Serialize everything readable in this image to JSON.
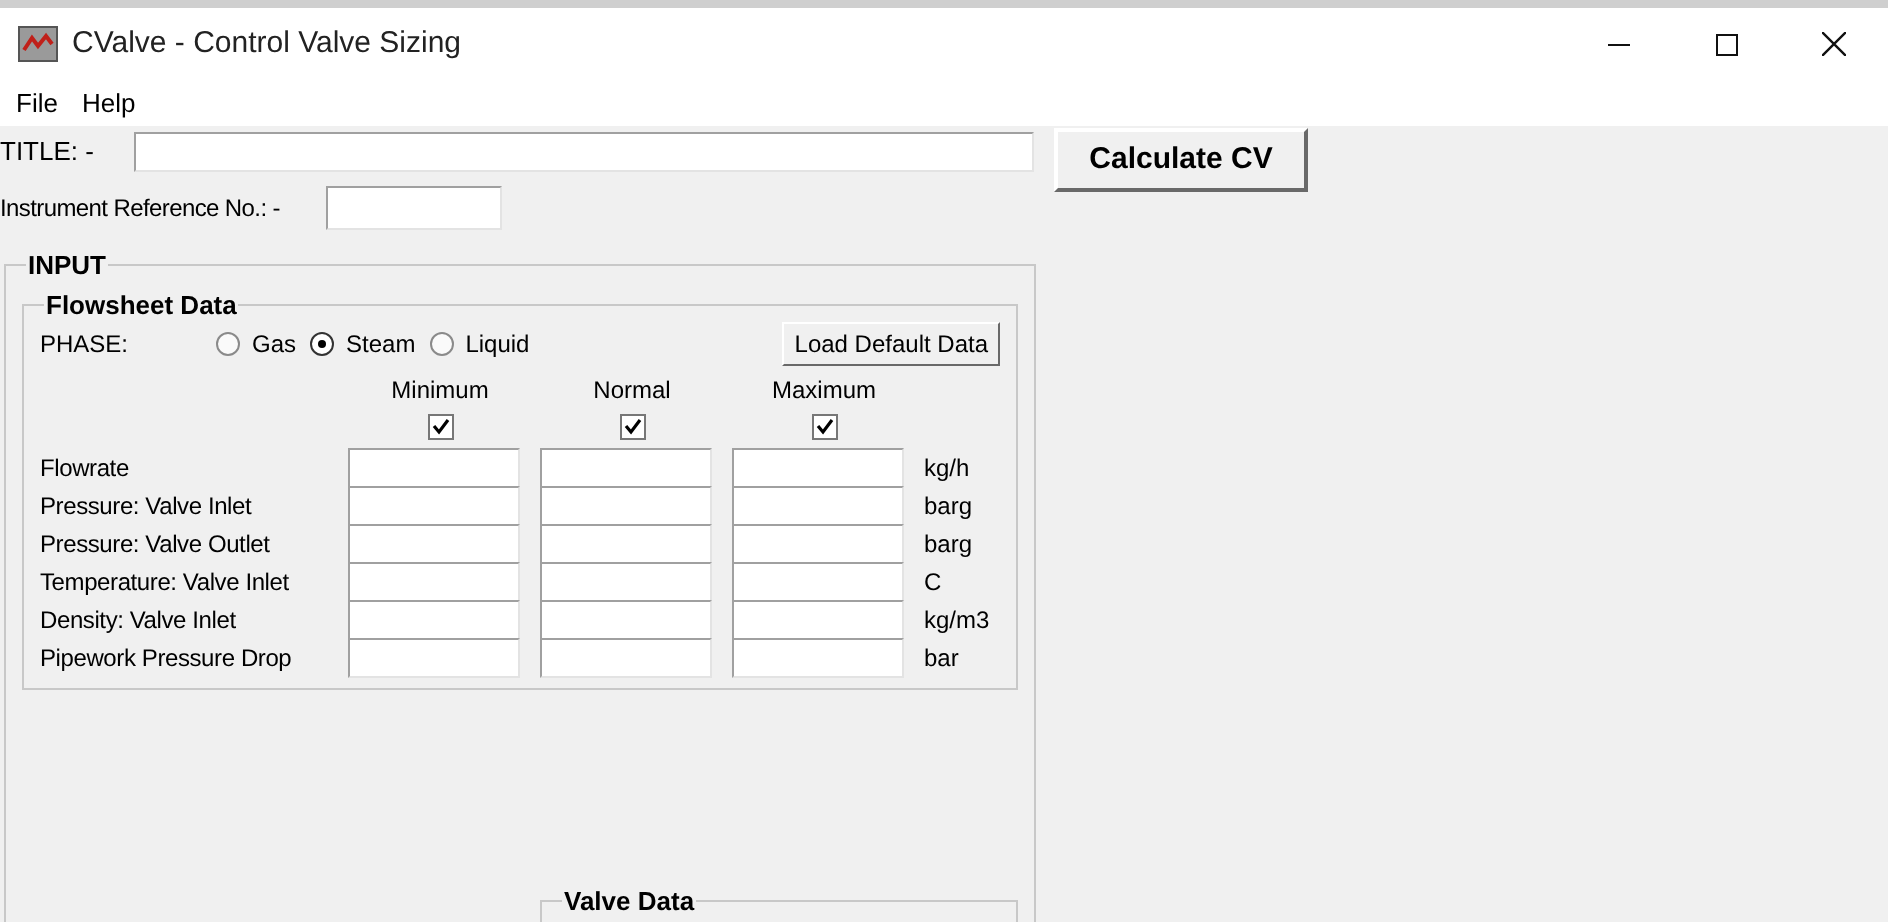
{
  "window": {
    "title": "CValve - Control Valve Sizing"
  },
  "menu": [
    {
      "label": "File"
    },
    {
      "label": "Help"
    }
  ],
  "title_field": {
    "label": "TITLE: -"
  },
  "instrument_ref": {
    "label": "Instrument Reference No.: -"
  },
  "calculate_button": "Calculate CV",
  "input_group": {
    "label": "INPUT",
    "flowsheet": {
      "label": "Flowsheet Data",
      "phase_label": "PHASE:",
      "phases": [
        {
          "label": "Gas",
          "selected": false
        },
        {
          "label": "Steam",
          "selected": true
        },
        {
          "label": "Liquid",
          "selected": false
        }
      ],
      "load_button": "Load Default Data",
      "columns": [
        {
          "label": "Minimum",
          "checked": true
        },
        {
          "label": "Normal",
          "checked": true
        },
        {
          "label": "Maximum",
          "checked": true
        }
      ],
      "rows": [
        {
          "label": "Flowrate",
          "unit": "kg/h"
        },
        {
          "label": "Pressure: Valve Inlet",
          "unit": "barg"
        },
        {
          "label": "Pressure: Valve Outlet",
          "unit": "barg"
        },
        {
          "label": "Temperature: Valve Inlet",
          "unit": "C"
        },
        {
          "label": "Density: Valve Inlet",
          "unit": "kg/m3"
        },
        {
          "label": "Pipework Pressure Drop",
          "unit": "bar"
        }
      ]
    },
    "valve_data": {
      "label": "Valve Data"
    }
  }
}
